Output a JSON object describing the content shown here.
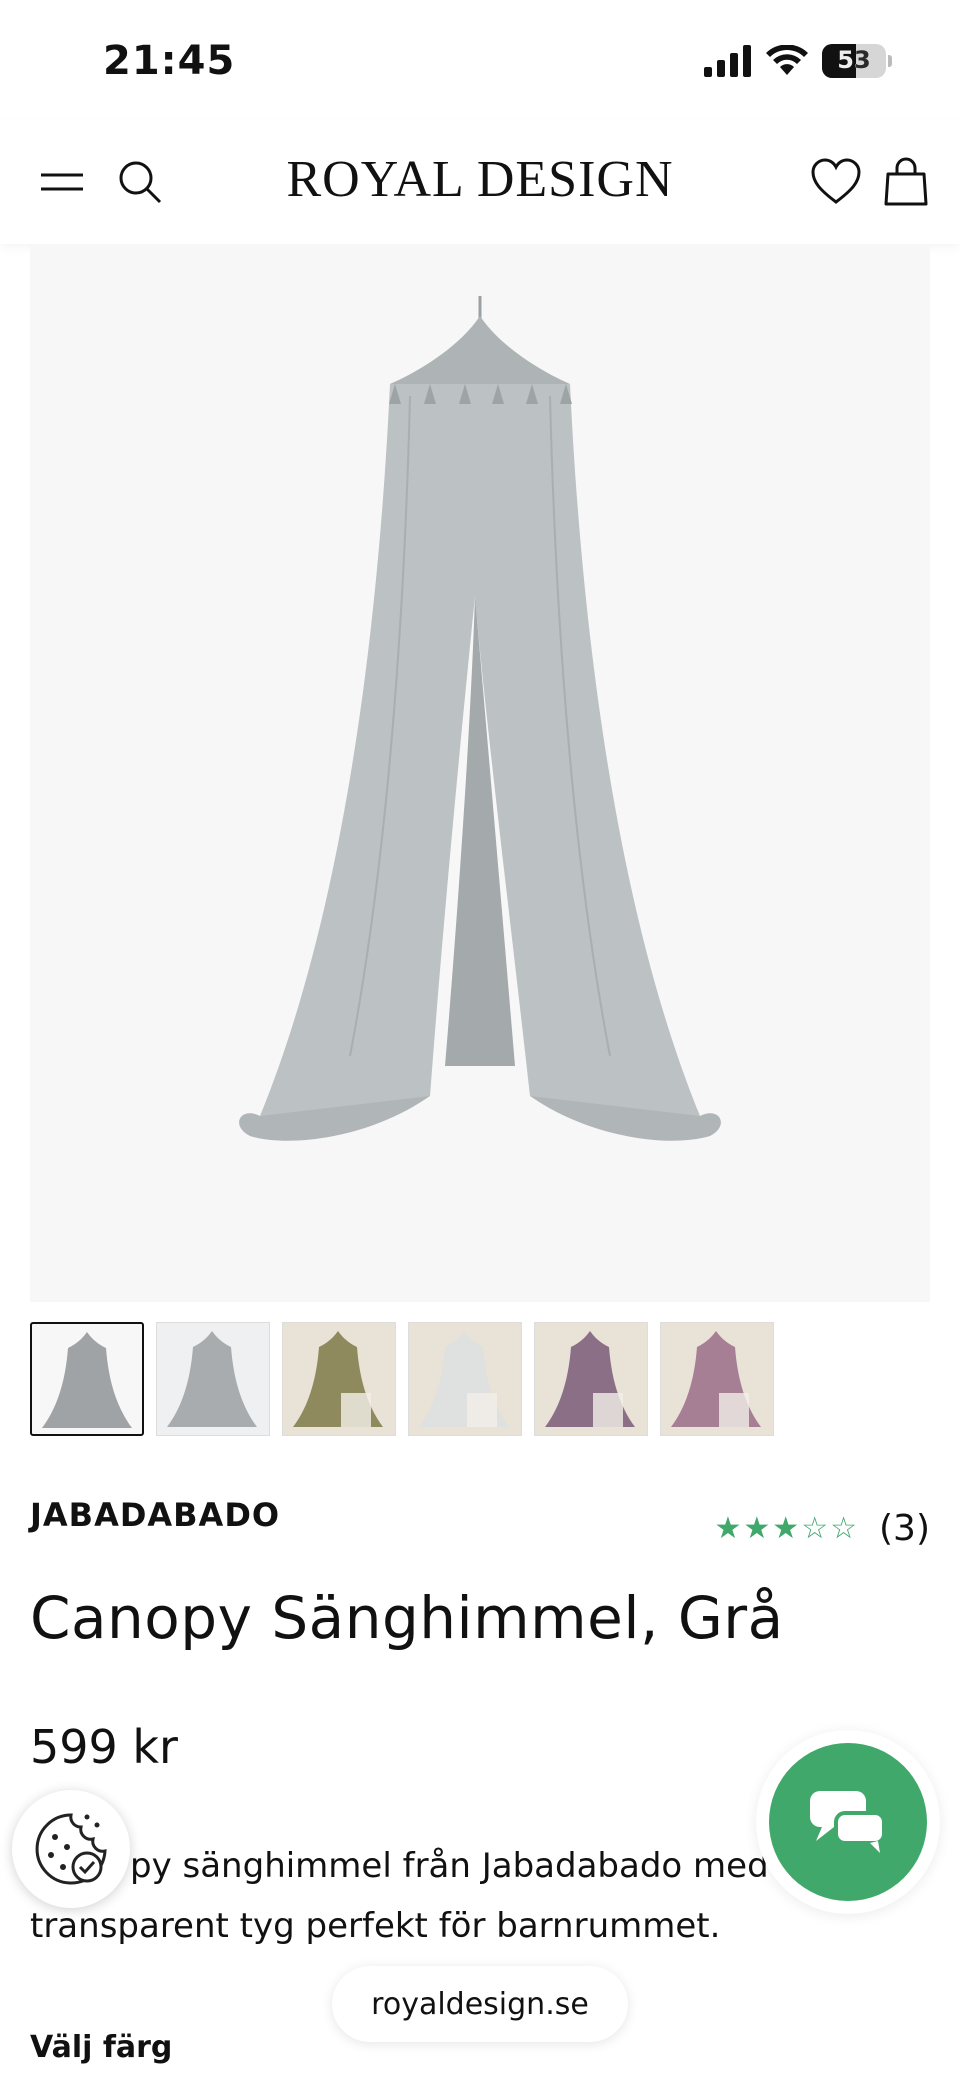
{
  "status_bar": {
    "time": "21:45",
    "battery": "53",
    "battery_level": 0.53
  },
  "header": {
    "brand": "ROYAL DESIGN"
  },
  "icons": {
    "menu": "hamburger-icon",
    "search": "search-icon",
    "wishlist": "heart-icon",
    "cart": "bag-icon"
  },
  "gallery": {
    "thumbnail_count": 6,
    "active_index": 0,
    "thumbnail_tints": [
      "#9fa3a5",
      "#a8acae",
      "#8f8a5e",
      "#dfe0e0",
      "#8a6f86",
      "#a67f95"
    ]
  },
  "product": {
    "brand": "JABADABADO",
    "rating_stars": "★★★☆☆",
    "rating_value": 3,
    "review_count": "(3)",
    "title": "Canopy Sänghimmel, Grå",
    "price": "599 kr",
    "description_line1": "py sänghimmel från Jabadabado med",
    "description_line2": "transparent tyg perfekt för barnrummet.",
    "choose_color_label": "Välj färg"
  },
  "browser": {
    "url": "royaldesign.se"
  },
  "colors": {
    "accent_green": "#3fa86a",
    "canopy_gray": "#b9bec0"
  }
}
